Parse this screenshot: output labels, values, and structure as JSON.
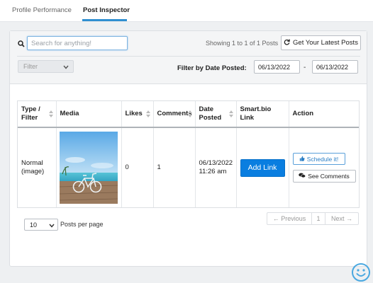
{
  "tabs": [
    {
      "label": "Profile Performance",
      "active": false
    },
    {
      "label": "Post Inspector",
      "active": true
    }
  ],
  "toolbar": {
    "search_placeholder": "Search for anything!",
    "showing_text": "Showing 1 to 1 of 1 Posts",
    "latest_posts_label": "Get Your Latest Posts",
    "filter_value": "Filter",
    "filter_by_date_label": "Filter by Date Posted:",
    "date_from": "06/13/2022",
    "date_separator": "-",
    "date_to": "06/13/2022"
  },
  "table": {
    "headers": [
      "Type / Filter",
      "Media",
      "Likes",
      "Comments",
      "Date Posted",
      "Smart.bio Link",
      "Action"
    ],
    "rows": [
      {
        "type": "Normal (image)",
        "media_icon": "photo-bicycle-beach",
        "likes": "0",
        "comments": "1",
        "date_posted": "06/13/2022 11:26 am",
        "add_link_label": "Add Link",
        "schedule_label": "Schedule it!",
        "see_comments_label": "See Comments"
      }
    ]
  },
  "footer": {
    "per_page_value": "10",
    "per_page_label": "Posts per page",
    "pagination": {
      "prev": "← Previous",
      "page": "1",
      "next": "Next →"
    }
  },
  "colors": {
    "accent": "#2f8fd1",
    "primary_button": "#0a7ee0",
    "smiley": "#4aa8e0"
  },
  "icons": [
    "search-icon",
    "refresh-icon",
    "chevron-down-icon",
    "sort-icon",
    "thumbs-up-icon",
    "comments-icon",
    "smiley-icon"
  ]
}
